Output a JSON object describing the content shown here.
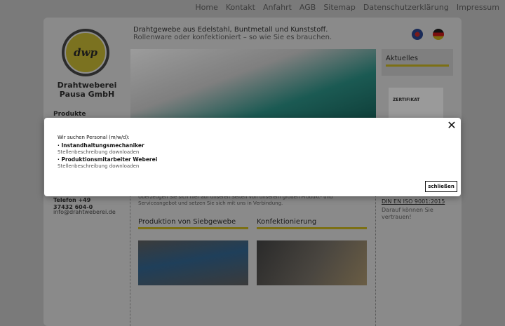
{
  "topnav": [
    "Home",
    "Kontakt",
    "Anfahrt",
    "AGB",
    "Sitemap",
    "Datenschutzerklärung",
    "Impressum"
  ],
  "logo_text": "dwp",
  "company": "Drahtweberei Pausa GmbH",
  "sidebar": {
    "products_label": "Produkte",
    "phone": "Telefon +49 37432 604-0",
    "email": "info@drahtweberei.de"
  },
  "header": {
    "headline": "Drahtgewebe aus Edelstahl, Buntmetall und Kunststoff.",
    "subline": "Rollenware oder konfektioniert – so wie Sie es brauchen."
  },
  "languages": [
    "english-flag",
    "german-flag"
  ],
  "aktuelles": {
    "title": "Aktuelles"
  },
  "certificate": {
    "title": "ZERTIFIKAT"
  },
  "main": {
    "intro": "Überzeugen Sie sich hier auf unseren Seiten von unserem großen Produkt- und Serviceangebot und setzen Sie sich mit uns in Verbindung.",
    "iso_link": "DIN EN ISO 9001:2015",
    "iso_text": "Darauf können Sie vertrauen!",
    "columns": [
      "Produktion von Siebgewebe",
      "Konfektionierung"
    ]
  },
  "modal": {
    "intro": "Wir suchen Personal (m/w/d):",
    "jobs": [
      {
        "title": "· Instandhaltungsmechaniker",
        "link": "Stellenbeschreibung downloaden"
      },
      {
        "title": "· Produktionsmitarbeiter Weberei",
        "link": "Stellenbeschreibung downloaden"
      }
    ],
    "close_label": "schließen",
    "close_icon": "close-icon"
  },
  "colors": {
    "accent": "#7c7014",
    "overlay": "#7a7a7a"
  }
}
